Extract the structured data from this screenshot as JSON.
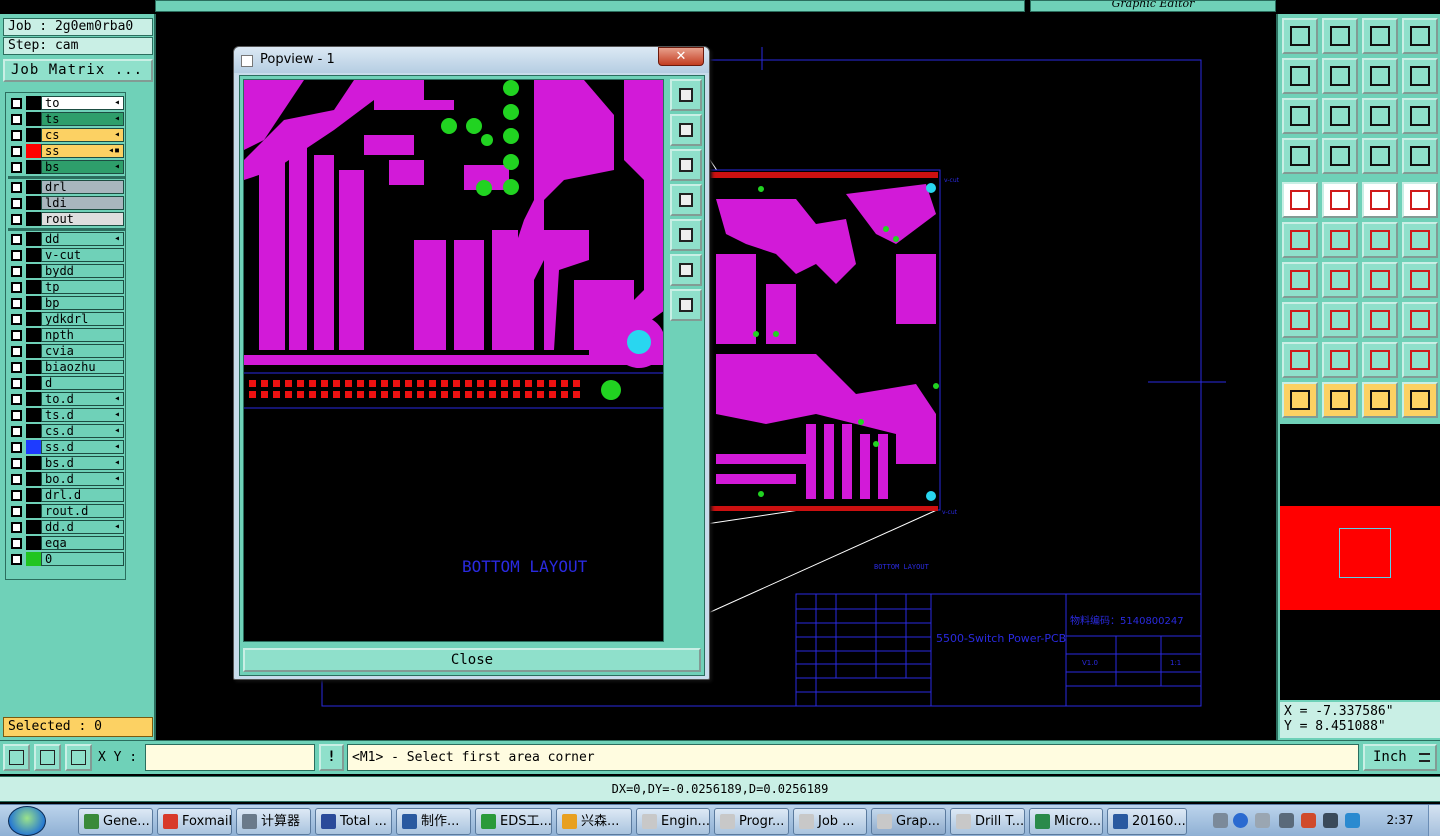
{
  "app": {
    "top_right_title": "Graphic Editor",
    "job_line": "Job : 2g0em0rba0",
    "step_line": "Step: cam",
    "job_matrix_label": "Job Matrix ...",
    "selected_label": "Selected : 0"
  },
  "layers": [
    {
      "name": "to",
      "color": "#000000",
      "bg": "#ffffff",
      "flag": "◂"
    },
    {
      "name": "ts",
      "color": "#000000",
      "bg": "#2e9e6b",
      "flag": "◂"
    },
    {
      "name": "cs",
      "color": "#000000",
      "bg": "#fcd163",
      "flag": "◂"
    },
    {
      "name": "ss",
      "color": "#ff0000",
      "bg": "#fcd163",
      "flag": "◂▪"
    },
    {
      "name": "bs",
      "color": "#000000",
      "bg": "#2e9e6b",
      "flag": "◂"
    },
    {
      "name": "drl",
      "color": "#000000",
      "bg": "#a8b6be",
      "flag": ""
    },
    {
      "name": "ldi",
      "color": "#000000",
      "bg": "#a8b6be",
      "flag": ""
    },
    {
      "name": "rout",
      "color": "#000000",
      "bg": "#dedede",
      "flag": ""
    },
    {
      "name": "dd",
      "color": "#000000",
      "bg": "#6fd1b8",
      "flag": "◂"
    },
    {
      "name": "v-cut",
      "color": "#000000",
      "bg": "#6fd1b8",
      "flag": ""
    },
    {
      "name": "bydd",
      "color": "#000000",
      "bg": "#6fd1b8",
      "flag": ""
    },
    {
      "name": "tp",
      "color": "#000000",
      "bg": "#6fd1b8",
      "flag": ""
    },
    {
      "name": "bp",
      "color": "#000000",
      "bg": "#6fd1b8",
      "flag": ""
    },
    {
      "name": "ydkdrl",
      "color": "#000000",
      "bg": "#6fd1b8",
      "flag": ""
    },
    {
      "name": "npth",
      "color": "#000000",
      "bg": "#6fd1b8",
      "flag": ""
    },
    {
      "name": "cvia",
      "color": "#000000",
      "bg": "#6fd1b8",
      "flag": ""
    },
    {
      "name": "biaozhu",
      "color": "#000000",
      "bg": "#6fd1b8",
      "flag": ""
    },
    {
      "name": "d",
      "color": "#000000",
      "bg": "#6fd1b8",
      "flag": ""
    },
    {
      "name": "to.d",
      "color": "#000000",
      "bg": "#6fd1b8",
      "flag": "◂"
    },
    {
      "name": "ts.d",
      "color": "#000000",
      "bg": "#6fd1b8",
      "flag": "◂"
    },
    {
      "name": "cs.d",
      "color": "#000000",
      "bg": "#6fd1b8",
      "flag": "◂"
    },
    {
      "name": "ss.d",
      "color": "#1e3cff",
      "bg": "#6fd1b8",
      "flag": "◂"
    },
    {
      "name": "bs.d",
      "color": "#000000",
      "bg": "#6fd1b8",
      "flag": "◂"
    },
    {
      "name": "bo.d",
      "color": "#000000",
      "bg": "#6fd1b8",
      "flag": "◂"
    },
    {
      "name": "drl.d",
      "color": "#000000",
      "bg": "#6fd1b8",
      "flag": ""
    },
    {
      "name": "rout.d",
      "color": "#000000",
      "bg": "#6fd1b8",
      "flag": ""
    },
    {
      "name": "dd.d",
      "color": "#000000",
      "bg": "#6fd1b8",
      "flag": "◂"
    },
    {
      "name": "eqa",
      "color": "#000000",
      "bg": "#6fd1b8",
      "flag": ""
    },
    {
      "name": "0",
      "color": "#21c521",
      "bg": "#6fd1b8",
      "flag": ""
    }
  ],
  "popview": {
    "title": "Popview - 1",
    "close_x": "✕",
    "close_button": "Close",
    "layout_text": "BOTTOM  LAYOUT"
  },
  "drawing": {
    "layout_text_small": "BOTTOM  LAYOUT",
    "product_name": "5500-Switch Power-PCB",
    "material_code": "物料编码：5140800247",
    "title_small_a": "V1.0",
    "title_small_b": "1:1",
    "vcut_label_top": "v-cut",
    "vcut_label_bottom": "v-cut"
  },
  "coords": {
    "x": "X = -7.337586\"",
    "y": "Y = 8.451088\""
  },
  "command": {
    "xy_label": "X Y :",
    "xy_value": "",
    "warn_label": "!",
    "prompt": "<M1> - Select first area corner",
    "unit": "Inch"
  },
  "status": {
    "text": "DX=0,DY=-0.0256189,D=0.0256189"
  },
  "taskbar": {
    "items": [
      {
        "label": "Gene...",
        "icon_color": "#3a8a3a"
      },
      {
        "label": "Foxmail",
        "icon_color": "#d83a2a"
      },
      {
        "label": "计算器",
        "icon_color": "#6a7a8a"
      },
      {
        "label": "Total ...",
        "icon_color": "#2a4a9a"
      },
      {
        "label": "制作...",
        "icon_color": "#2a5aa0"
      },
      {
        "label": "EDS工...",
        "icon_color": "#2a9a3a"
      },
      {
        "label": "兴森...",
        "icon_color": "#e8a020"
      },
      {
        "label": "Engin...",
        "icon_color": "#c8c8c8"
      },
      {
        "label": "Progr...",
        "icon_color": "#c8c8c8"
      },
      {
        "label": "Job ...",
        "icon_color": "#c8c8c8"
      },
      {
        "label": "Grap...",
        "icon_color": "#c8c8c8"
      },
      {
        "label": "Drill T...",
        "icon_color": "#c8c8c8"
      },
      {
        "label": "Micro...",
        "icon_color": "#2a8a4a"
      },
      {
        "label": "20160...",
        "icon_color": "#2a5aa0"
      }
    ],
    "clock": "2:37"
  }
}
